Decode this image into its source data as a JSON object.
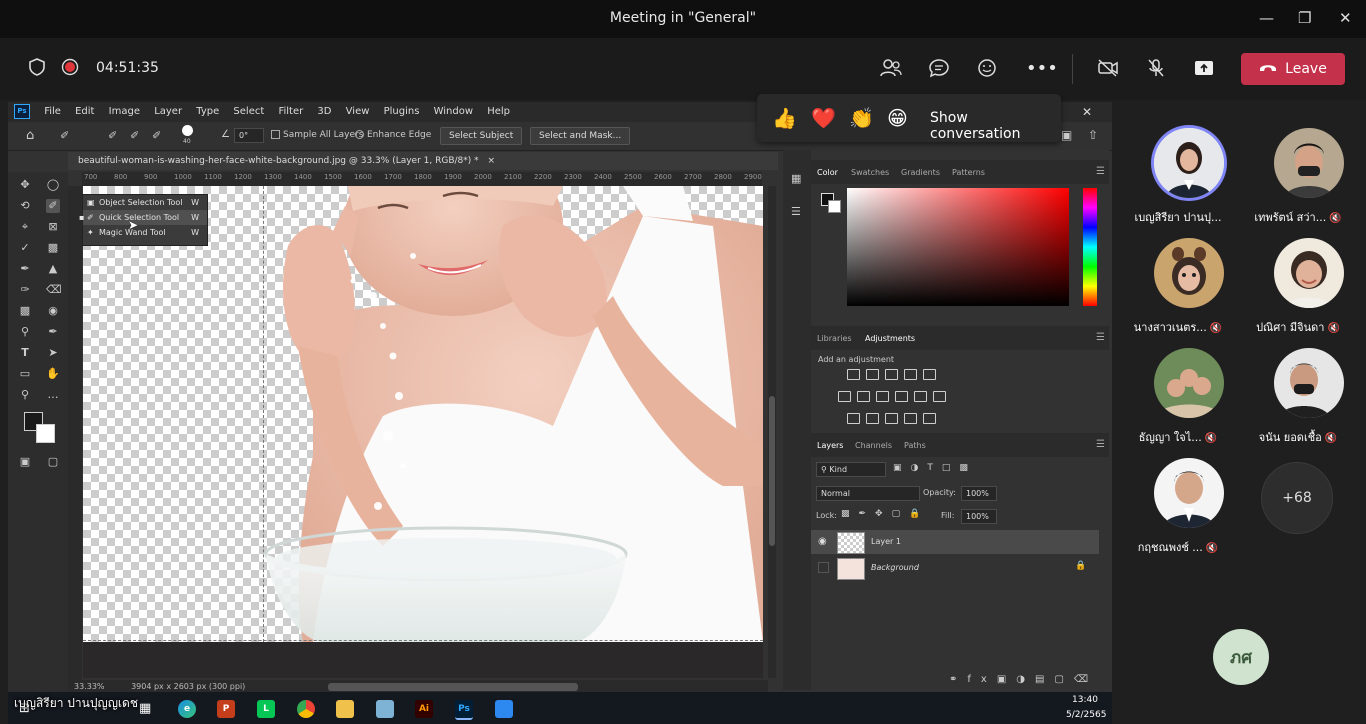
{
  "teams": {
    "window_title": "Meeting in \"General\"",
    "timer": "04:51:35",
    "leave_label": "Leave",
    "reactions": [
      "👍",
      "❤️",
      "👏",
      "😁"
    ],
    "show_conversation": "Show conversation",
    "overflow_count": "+68",
    "self_initials": "ภศ",
    "presenter_name": "เบญสิรียา ปานปุญญเดช",
    "participants": [
      {
        "name": "เบญสิรียา ปานปุ...",
        "muted": false
      },
      {
        "name": "เทพรัตน์ สว่า...",
        "muted": true
      },
      {
        "name": "นางสาวเนตร...",
        "muted": true
      },
      {
        "name": "ปณิศา มีจินดา",
        "muted": true
      },
      {
        "name": "ธัญญา ใจไ...",
        "muted": true
      },
      {
        "name": "จนัน ยอดเชื้อ",
        "muted": true
      },
      {
        "name": "กฤชณพงช์ ...",
        "muted": true
      }
    ]
  },
  "photoshop": {
    "menu": [
      "File",
      "Edit",
      "Image",
      "Layer",
      "Type",
      "Select",
      "Filter",
      "3D",
      "View",
      "Plugins",
      "Window",
      "Help"
    ],
    "options": {
      "brush_size": "40",
      "angle": "0°",
      "sample_all_layers": "Sample All Layers",
      "enhance_edge": "Enhance Edge",
      "select_subject": "Select Subject",
      "select_and_mask": "Select and Mask..."
    },
    "doc_tab": "beautiful-woman-is-washing-her-face-white-background.jpg @ 33.3% (Layer 1, RGB/8*) *",
    "ruler_ticks": [
      "700",
      "800",
      "900",
      "1000",
      "1100",
      "1200",
      "1300",
      "1400",
      "1500",
      "1600",
      "1700",
      "1800",
      "1900",
      "2000",
      "2100",
      "2200",
      "2300",
      "2400",
      "2500",
      "2600",
      "2700",
      "2800",
      "2900"
    ],
    "flyout": [
      {
        "label": "Object Selection Tool",
        "key": "W"
      },
      {
        "label": "Quick Selection Tool",
        "key": "W"
      },
      {
        "label": "Magic Wand Tool",
        "key": "W"
      }
    ],
    "status": {
      "zoom": "33.33%",
      "doc_info": "3904 px x 2603 px (300 ppi)"
    },
    "color_tabs": [
      "Color",
      "Swatches",
      "Gradients",
      "Patterns"
    ],
    "adj_tabs": [
      "Libraries",
      "Adjustments"
    ],
    "add_adjustment": "Add an adjustment",
    "layer_tabs": [
      "Layers",
      "Channels",
      "Paths"
    ],
    "kind": "Kind",
    "blend_mode": "Normal",
    "opacity_label": "Opacity:",
    "opacity": "100%",
    "lock_label": "Lock:",
    "fill_label": "Fill:",
    "fill": "100%",
    "layers": [
      "Layer 1",
      "Background"
    ]
  },
  "taskbar": {
    "time": "13:40",
    "date": "5/2/2565"
  }
}
